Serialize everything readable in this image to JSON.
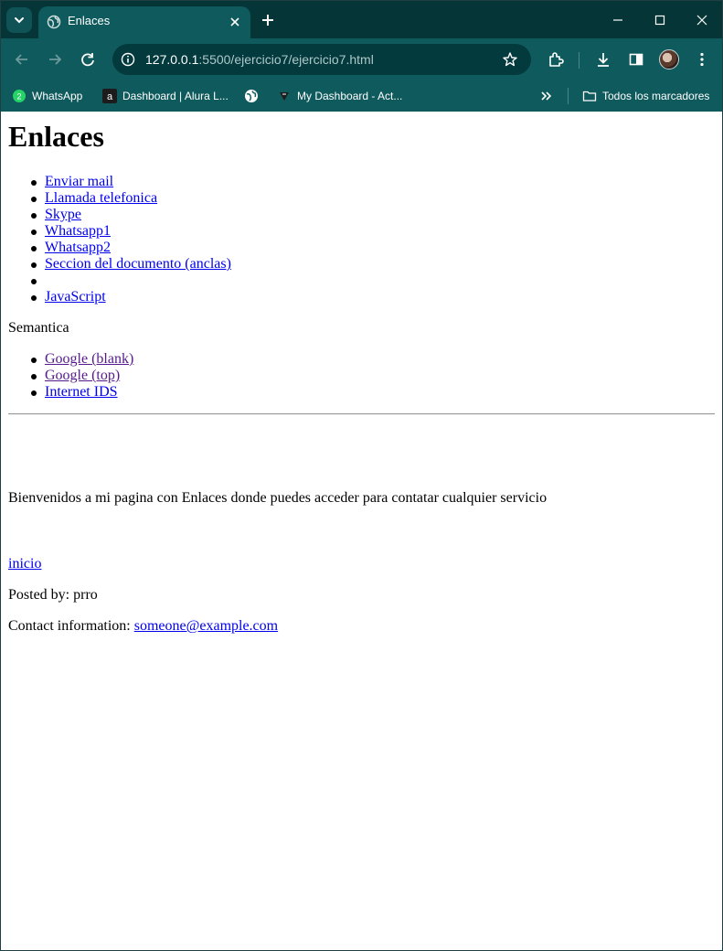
{
  "browser": {
    "tab_title": "Enlaces",
    "url_host": "127.0.0.1",
    "url_path": ":5500/ejercicio7/ejercicio7.html",
    "bookmarks": [
      {
        "label": "WhatsApp",
        "icon": "whatsapp-icon"
      },
      {
        "label": "Dashboard | Alura L...",
        "icon": "alura-icon"
      },
      {
        "label": "",
        "icon": "globe-icon"
      },
      {
        "label": "My Dashboard - Act...",
        "icon": "dashboard-icon"
      }
    ],
    "all_bookmarks_label": "Todos los marcadores"
  },
  "page": {
    "heading": "Enlaces",
    "links": [
      "Enviar mail",
      "Llamada telefonica",
      "Skype",
      "Whatsapp1",
      "Whatsapp2",
      "Seccion del documento (anclas)",
      "",
      "JavaScript"
    ],
    "semantica_label": "Semantica",
    "semantic_links": [
      "Google (blank)",
      "Google (top)",
      "Internet IDS"
    ],
    "welcome_text": "Bienvenidos a mi pagina con Enlaces donde puedes acceder para contatar cualquier servicio",
    "inicio_link": "inicio",
    "posted_by": "Posted by: prro",
    "contact_label": "Contact information: ",
    "contact_email": "someone@example.com"
  },
  "colors": {
    "titlebar": "#053537",
    "toolbar": "#0f5a5d",
    "link": "#0000ee",
    "visited_link": "#551a8b"
  }
}
